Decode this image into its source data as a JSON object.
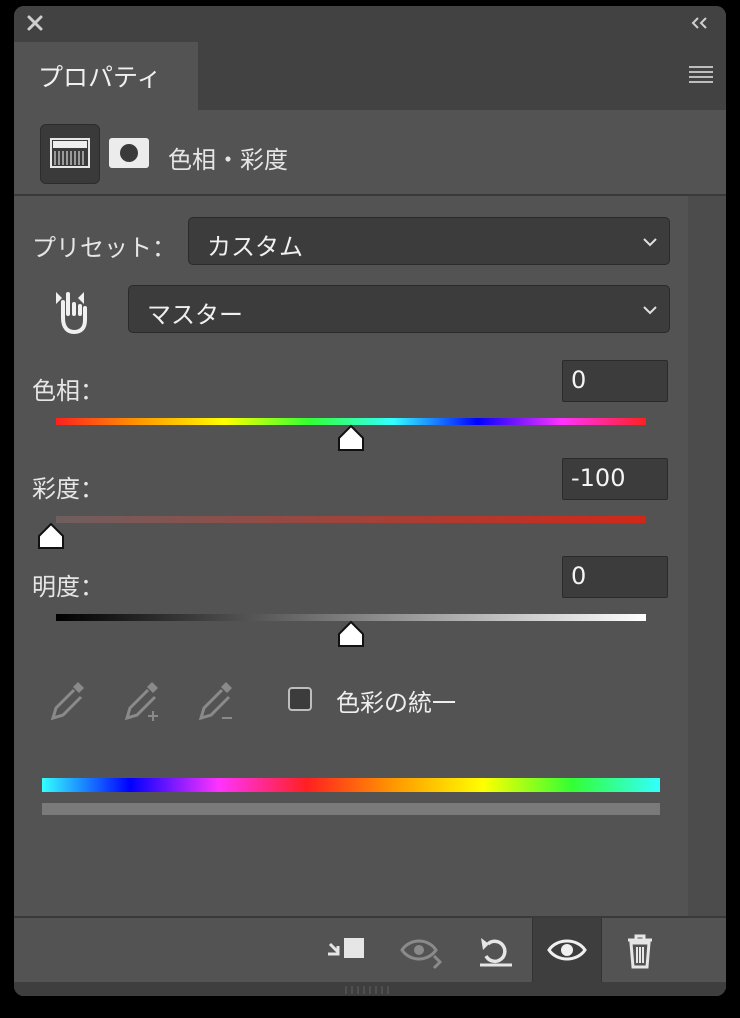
{
  "panel": {
    "tab_label": "プロパティ",
    "adjustment_title": "色相・彩度"
  },
  "preset": {
    "label": "プリセット：",
    "value": "カスタム"
  },
  "channel": {
    "value": "マスター"
  },
  "hue": {
    "label": "色相：",
    "value": "0",
    "level": 0.5
  },
  "saturation": {
    "label": "彩度：",
    "value": "-100",
    "level": 0.0
  },
  "lightness": {
    "label": "明度：",
    "value": "0",
    "level": 0.5
  },
  "colorize": {
    "label": "色彩の統一",
    "checked": false
  },
  "icons": {
    "close": "close-icon",
    "collapse": "double-chevron-left-icon",
    "menu": "hamburger-menu-icon",
    "adjustment": "hue-saturation-icon",
    "mask": "mask-icon",
    "target": "hand-target-icon",
    "eyedroppers": [
      "eyedropper-icon",
      "eyedropper-plus-icon",
      "eyedropper-minus-icon"
    ],
    "footer": [
      "clip-to-layer-icon",
      "view-previous-state-icon",
      "reset-icon",
      "visibility-eye-icon",
      "trash-icon"
    ]
  },
  "colors": {
    "panel_bg": "#535353",
    "field_bg": "#3c3c3c",
    "text": "#e6e6e6"
  }
}
